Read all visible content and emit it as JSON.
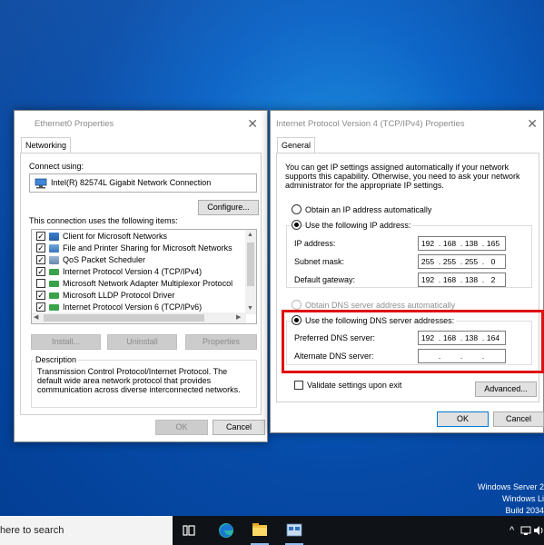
{
  "ethernet_props": {
    "title": "Ethernet0 Properties",
    "tab": "Networking",
    "connect_using_label": "Connect using:",
    "adapter": "Intel(R) 82574L Gigabit Network Connection",
    "configure_button": "Configure...",
    "items_label": "This connection uses the following items:",
    "items": [
      {
        "label": "Client for Microsoft Networks",
        "checked": true,
        "icon": "client-icon"
      },
      {
        "label": "File and Printer Sharing for Microsoft Networks",
        "checked": true,
        "icon": "file-share-icon"
      },
      {
        "label": "QoS Packet Scheduler",
        "checked": true,
        "icon": "qos-icon"
      },
      {
        "label": "Internet Protocol Version 4 (TCP/IPv4)",
        "checked": true,
        "icon": "protocol-icon"
      },
      {
        "label": "Microsoft Network Adapter Multiplexor Protocol",
        "checked": false,
        "icon": "protocol-icon"
      },
      {
        "label": "Microsoft LLDP Protocol Driver",
        "checked": true,
        "icon": "protocol-icon"
      },
      {
        "label": "Internet Protocol Version 6 (TCP/IPv6)",
        "checked": true,
        "icon": "protocol-icon"
      }
    ],
    "install_button": "Install...",
    "uninstall_button": "Uninstall",
    "properties_button": "Properties",
    "description_legend": "Description",
    "description_text": "Transmission Control Protocol/Internet Protocol. The default wide area network protocol that provides communication across diverse interconnected networks.",
    "ok_button": "OK",
    "cancel_button": "Cancel"
  },
  "ipv4_props": {
    "title": "Internet Protocol Version 4 (TCP/IPv4) Properties",
    "tab": "General",
    "intro_text": "You can get IP settings assigned automatically if your network supports this capability. Otherwise, you need to ask your network administrator for the appropriate IP settings.",
    "obtain_ip_auto": "Obtain an IP address automatically",
    "use_following_ip": "Use the following IP address:",
    "ip_address_label": "IP address:",
    "ip_address": [
      "192",
      "168",
      "138",
      "165"
    ],
    "subnet_label": "Subnet mask:",
    "subnet": [
      "255",
      "255",
      "255",
      "0"
    ],
    "gateway_label": "Default gateway:",
    "gateway": [
      "192",
      "168",
      "138",
      "2"
    ],
    "obtain_dns_auto": "Obtain DNS server address automatically",
    "use_following_dns": "Use the following DNS server addresses:",
    "preferred_dns_label": "Preferred DNS server:",
    "preferred_dns": [
      "192",
      "168",
      "138",
      "164"
    ],
    "alternate_dns_label": "Alternate DNS server:",
    "alternate_dns": [
      "",
      "",
      "",
      ""
    ],
    "validate_label": "Validate settings upon exit",
    "advanced_button": "Advanced...",
    "ok_button": "OK",
    "cancel_button": "Cancel",
    "highlight_color": "#e01010"
  },
  "desktop": {
    "watermark_line1": "Windows Server 2",
    "watermark_line2": "Windows Li",
    "watermark_line3": "Build 2034"
  },
  "taskbar": {
    "search_text": "here to search",
    "icons": [
      "task-view-icon",
      "edge-icon",
      "file-explorer-icon",
      "network-app-icon"
    ],
    "tray_caret": "^",
    "tray_icons": [
      "network-tray-icon",
      "volume-tray-icon"
    ]
  }
}
